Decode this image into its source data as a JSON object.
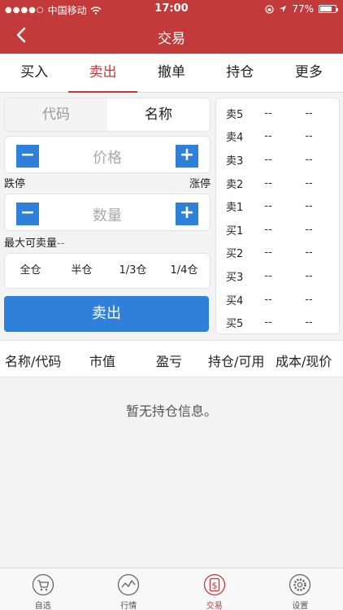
{
  "status": {
    "carrier": "中国移动",
    "time": "17:00",
    "battery": "77%",
    "battery_level": 0.77
  },
  "nav": {
    "title": "交易"
  },
  "tabs": [
    {
      "label": "买入"
    },
    {
      "label": "卖出",
      "active": true
    },
    {
      "label": "撤单"
    },
    {
      "label": "持仓"
    },
    {
      "label": "更多"
    }
  ],
  "segment": {
    "code": "代码",
    "name": "名称"
  },
  "price": {
    "minus": "−",
    "plus": "+",
    "placeholder": "价格"
  },
  "limits": {
    "down": "跌停",
    "up": "涨停"
  },
  "quantity": {
    "minus": "−",
    "plus": "+",
    "placeholder": "数量"
  },
  "max_sell": {
    "label": "最大可卖量",
    "value": "--"
  },
  "quick": [
    "全仓",
    "半仓",
    "1/3仓",
    "1/4仓"
  ],
  "sell_button": "卖出",
  "order_book": [
    {
      "label": "卖5",
      "price": "--",
      "volume": "--"
    },
    {
      "label": "卖4",
      "price": "--",
      "volume": "--"
    },
    {
      "label": "卖3",
      "price": "--",
      "volume": "--"
    },
    {
      "label": "卖2",
      "price": "--",
      "volume": "--"
    },
    {
      "label": "卖1",
      "price": "--",
      "volume": "--"
    },
    {
      "label": "买1",
      "price": "--",
      "volume": "--"
    },
    {
      "label": "买2",
      "price": "--",
      "volume": "--"
    },
    {
      "label": "买3",
      "price": "--",
      "volume": "--"
    },
    {
      "label": "买4",
      "price": "--",
      "volume": "--"
    },
    {
      "label": "买5",
      "price": "--",
      "volume": "--"
    }
  ],
  "holdings_header": [
    "名称/代码",
    "市值",
    "盈亏",
    "持仓/可用",
    "成本/现价"
  ],
  "empty_text": "暂无持仓信息。",
  "bottom": [
    {
      "label": "自选",
      "icon": "cart-icon"
    },
    {
      "label": "行情",
      "icon": "chart-icon"
    },
    {
      "label": "交易",
      "icon": "dollar-icon",
      "active": true
    },
    {
      "label": "设置",
      "icon": "gear-icon"
    }
  ],
  "colors": {
    "brand": "#c23b3a",
    "accent": "#2f80d8"
  }
}
